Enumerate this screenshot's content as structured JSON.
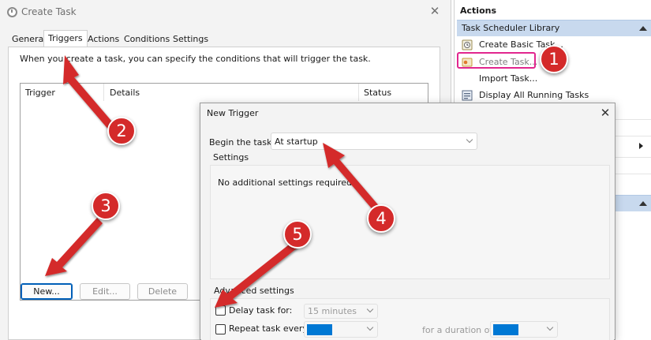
{
  "create_task": {
    "title": "Create Task",
    "tabs": [
      "General",
      "Triggers",
      "Actions",
      "Conditions",
      "Settings"
    ],
    "active_tab": "Triggers",
    "intro": "When you create a task, you can specify the conditions that will trigger the task.",
    "columns": [
      "Trigger",
      "Details",
      "Status"
    ],
    "buttons": {
      "new": "New...",
      "edit": "Edit...",
      "delete": "Delete"
    }
  },
  "actions_panel": {
    "header": "Actions",
    "section": "Task Scheduler Library",
    "items": [
      {
        "label": "Create Basic Task...",
        "icon": "basic-task-icon"
      },
      {
        "label": "Create Task...",
        "icon": "create-task-icon"
      },
      {
        "label": "Import Task...",
        "icon": ""
      },
      {
        "label": "Display All Running Tasks",
        "icon": "running-tasks-icon"
      }
    ]
  },
  "new_trigger": {
    "title": "New Trigger",
    "begin_label": "Begin the task:",
    "begin_value": "At startup",
    "settings_label": "Settings",
    "settings_text": "No additional settings required.",
    "advanced_label": "Advanced settings",
    "delay_label": "Delay task for:",
    "delay_value": "15 minutes",
    "repeat_label": "Repeat task every:",
    "duration_label": "for a duration of:"
  },
  "callouts": [
    "1",
    "2",
    "3",
    "4",
    "5"
  ],
  "colors": {
    "callout": "#d42a2a",
    "highlight_box": "#e1268e",
    "section_header": "#c8d9ee",
    "selection_blue": "#0078d4"
  }
}
